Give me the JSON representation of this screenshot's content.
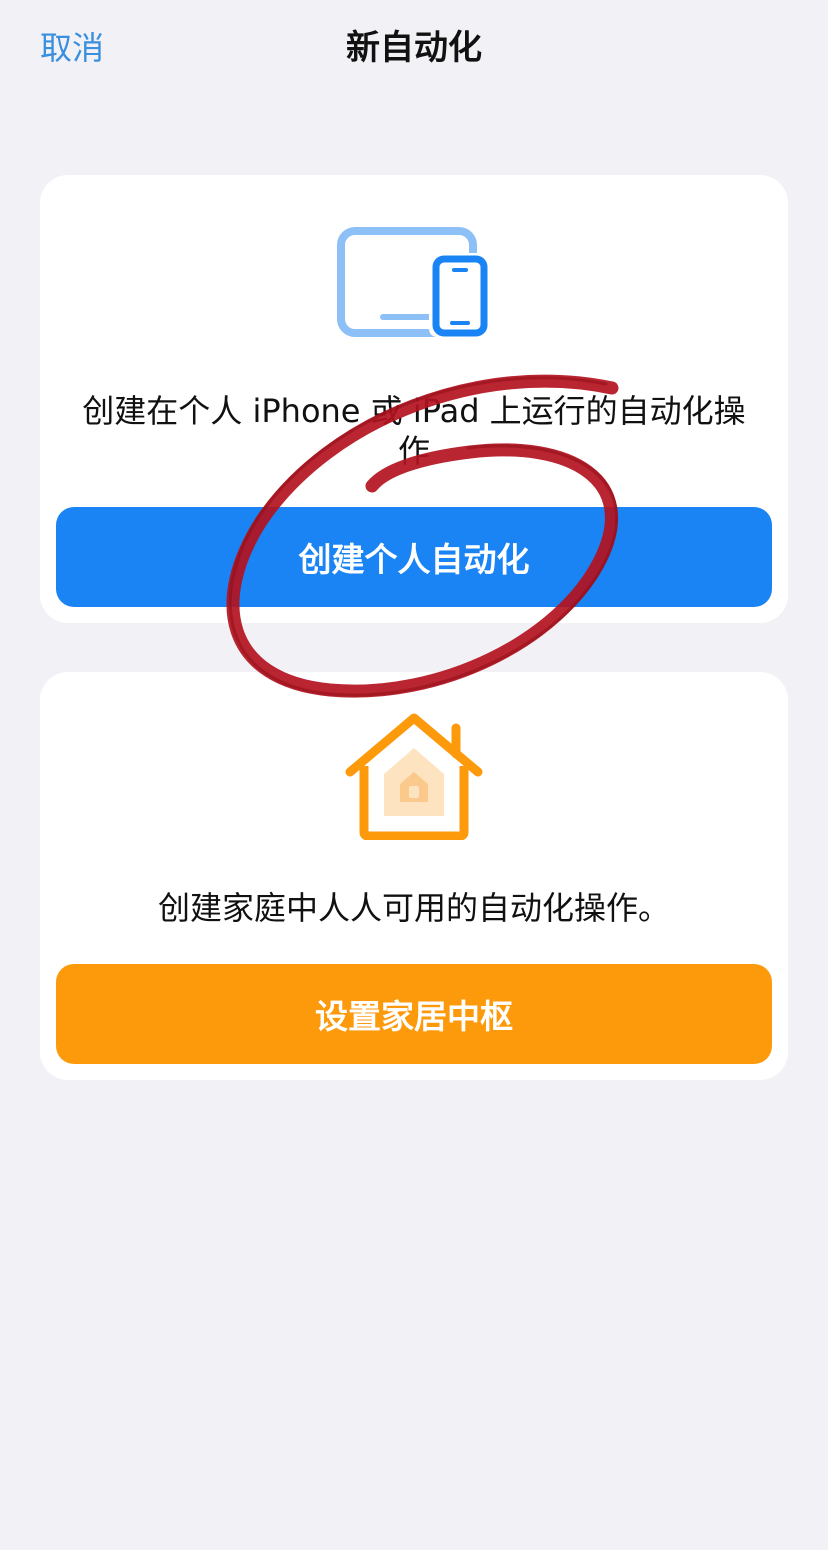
{
  "nav": {
    "cancel_label": "取消",
    "title": "新自动化"
  },
  "personal_card": {
    "icon": "ipad-iphone-icon",
    "description": "创建在个人 iPhone 或 iPad 上运行的自动化操作",
    "button_label": "创建个人自动化",
    "accent_color": "#1a84f5"
  },
  "home_card": {
    "icon": "home-icon",
    "description": "创建家庭中人人可用的自动化操作。",
    "button_label": "设置家居中枢",
    "accent_color": "#fd9a0c"
  },
  "colors": {
    "background": "#f2f1f6",
    "card": "#ffffff",
    "link": "#3a8fde",
    "annotation": "#b3121e"
  }
}
